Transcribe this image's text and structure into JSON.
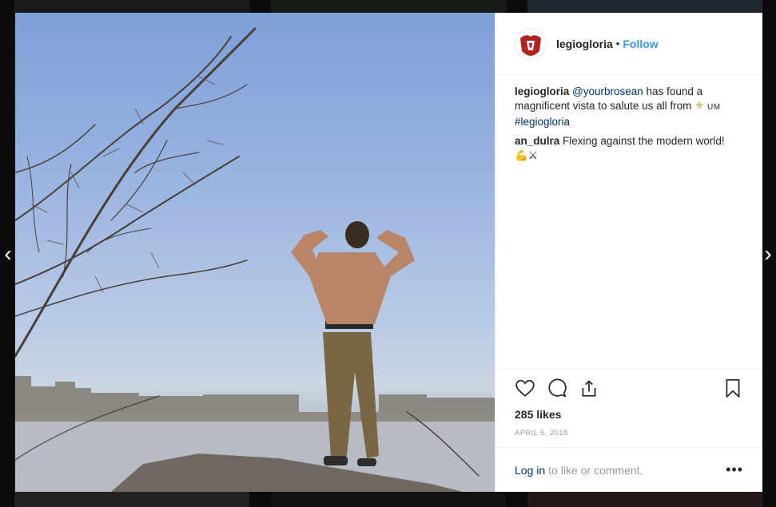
{
  "post": {
    "username": "legiogloria",
    "follow_label": "Follow",
    "separator": "•",
    "caption": {
      "user": "legiogloria",
      "mention": "@yourbrosean",
      "text": " has found a magnificent vista to salute us all from ",
      "emoji": "⚜",
      "suffix": "UM",
      "hashtag": "#legiogloria"
    },
    "comments": [
      {
        "user": "an_dulra",
        "text": "Flexing against the modern world!",
        "emoji": "💪⚔"
      }
    ],
    "likes": "285 likes",
    "date": "APRIL 5, 2018",
    "login_link": "Log in",
    "login_text": "to like or comment.",
    "more_label": "•••"
  },
  "nav": {
    "left": "‹",
    "right": "›"
  },
  "colors": {
    "link": "#3897f0",
    "mention": "#003569",
    "brand": "#b22222"
  },
  "icons": [
    "heart-icon",
    "comment-icon",
    "share-icon",
    "bookmark-icon",
    "more-icon",
    "logo-icon"
  ]
}
